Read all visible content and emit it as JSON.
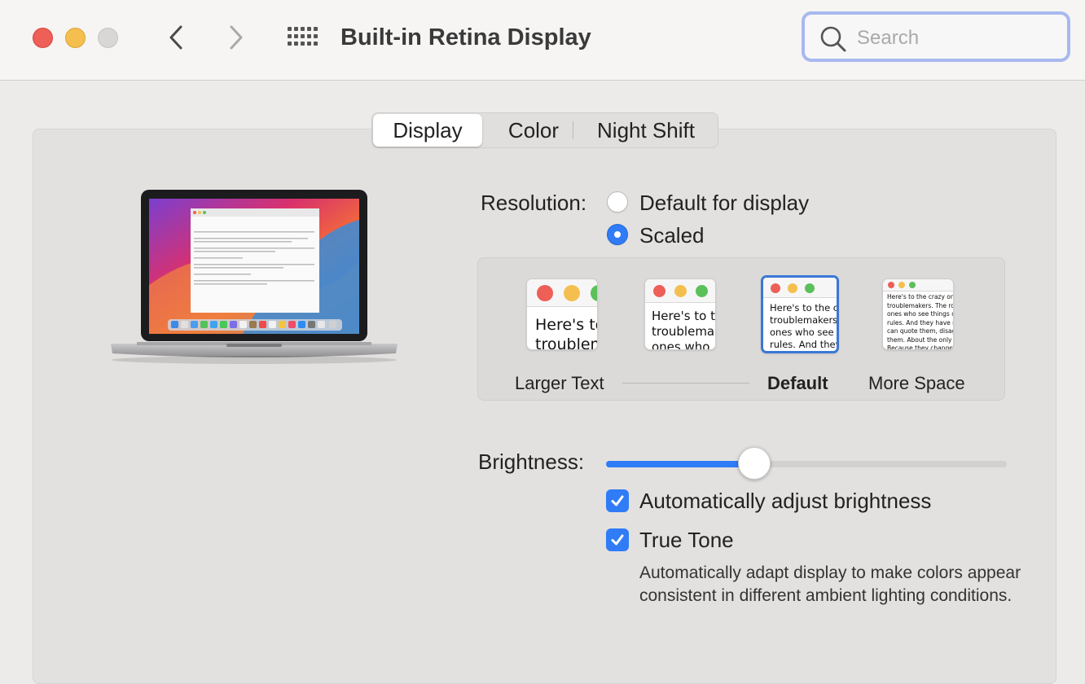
{
  "window": {
    "title": "Built-in Retina Display",
    "search": {
      "placeholder": "Search",
      "value": ""
    }
  },
  "tabs": [
    {
      "label": "Display",
      "selected": true
    },
    {
      "label": "Color",
      "selected": false
    },
    {
      "label": "Night Shift",
      "selected": false
    }
  ],
  "resolution": {
    "label": "Resolution:",
    "options": [
      {
        "label": "Default for display",
        "selected": false
      },
      {
        "label": "Scaled",
        "selected": true
      }
    ],
    "scales": [
      {
        "label": "Larger Text",
        "preview": "Here's to\ntroublem",
        "selected": false
      },
      {
        "label": "",
        "preview": "Here's to t\ntroublema\nones who",
        "selected": false
      },
      {
        "label": "Default",
        "preview": "Here's to the cr\ntroublemakers.\nones who see t\nrules. And they",
        "selected": true
      },
      {
        "label": "More Space",
        "preview": "Here's to the crazy one\ntroublemakers. The rou\nones who see things dif\nrules. And they have no\ncan quote them, disagre\nthem. About the only th\nBecause they change th",
        "selected": false
      }
    ]
  },
  "brightness": {
    "label": "Brightness:",
    "level": 0.37,
    "auto_adjust": {
      "label": "Automatically adjust brightness",
      "checked": true
    },
    "true_tone": {
      "label": "True Tone",
      "checked": true,
      "description": "Automatically adapt display to make colors appear consistent in different ambient lighting conditions."
    }
  },
  "colors": {
    "accent": "#2f7cf6",
    "close": "#ed5f57",
    "minimize": "#f4bf4f",
    "zoom_disabled": "#d9d7d5"
  },
  "icons": {
    "back": "chevron-left-icon",
    "forward": "chevron-right-icon",
    "show_all": "grid-icon",
    "search": "magnifier-icon"
  }
}
